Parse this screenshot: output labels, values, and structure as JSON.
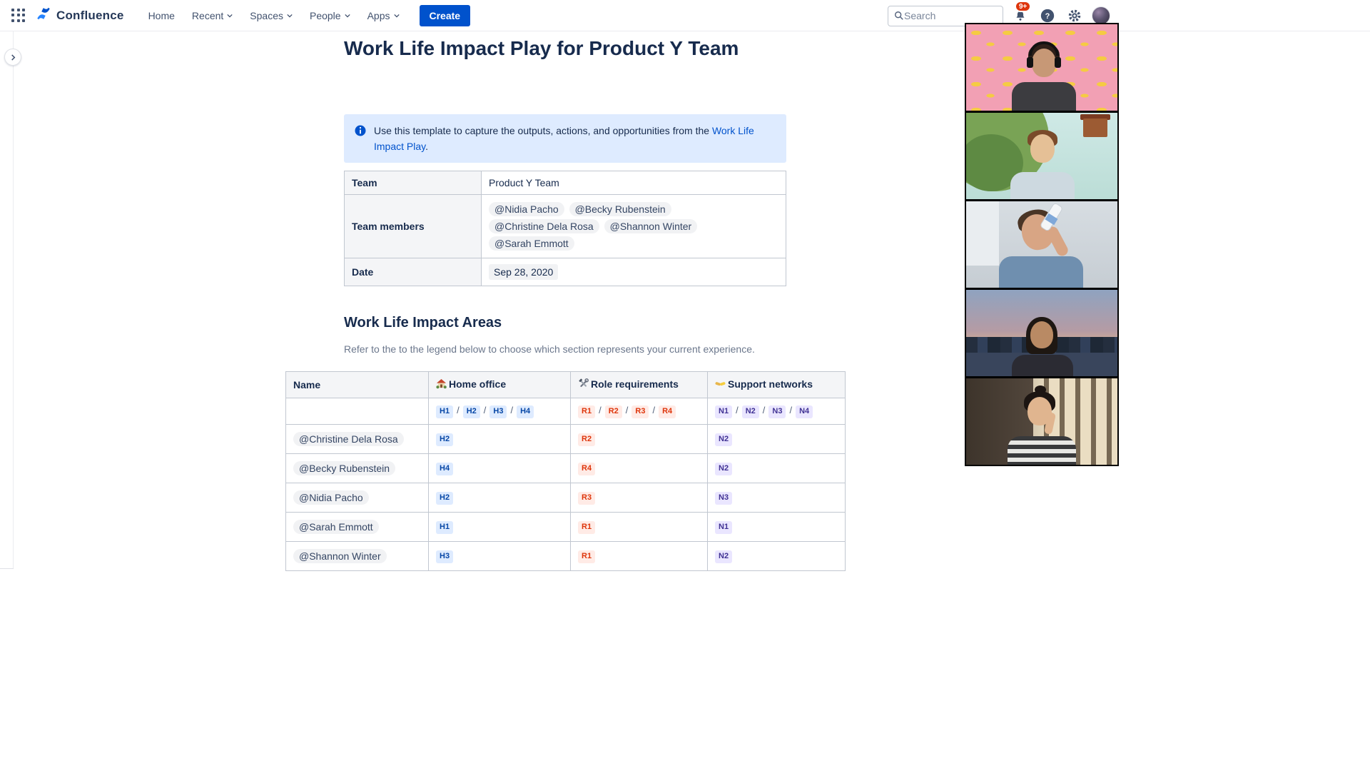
{
  "nav": {
    "brand": "Confluence",
    "items": [
      {
        "label": "Home"
      },
      {
        "label": "Recent"
      },
      {
        "label": "Spaces"
      },
      {
        "label": "People"
      },
      {
        "label": "Apps"
      }
    ],
    "create_label": "Create",
    "search_placeholder": "Search",
    "notification_badge": "9+"
  },
  "page": {
    "title": "Work Life Impact Play for Product Y Team",
    "info": {
      "before": "Use this template to capture the outputs, actions, and opportunities from the ",
      "link": "Work Life Impact Play",
      "after": "."
    },
    "team_table": {
      "team_label": "Team",
      "team_value": "Product Y Team",
      "members_label": "Team members",
      "members": [
        "@Nidia Pacho",
        "@Becky Rubenstein",
        "@Christine Dela Rosa",
        "@Shannon Winter",
        "@Sarah Emmott"
      ],
      "date_label": "Date",
      "date_value": "Sep 28, 2020"
    },
    "section_heading": "Work Life Impact Areas",
    "section_subtext": "Refer to the to the legend below to choose which section represents your current experience.",
    "impact_table": {
      "headers": {
        "name": "Name",
        "home": "Home office",
        "home_icon": "house",
        "role": "Role requirements",
        "role_icon": "hammer-and-wrench",
        "network": "Support networks",
        "network_icon": "handshake"
      },
      "separator": "/",
      "legend": {
        "home": [
          "H1",
          "H2",
          "H3",
          "H4"
        ],
        "role": [
          "R1",
          "R2",
          "R3",
          "R4"
        ],
        "network": [
          "N1",
          "N2",
          "N3",
          "N4"
        ]
      },
      "rows": [
        {
          "name": "@Christine Dela Rosa",
          "home": "H2",
          "role": "R2",
          "network": "N2"
        },
        {
          "name": "@Becky Rubenstein",
          "home": "H4",
          "role": "R4",
          "network": "N2"
        },
        {
          "name": "@Nidia Pacho",
          "home": "H2",
          "role": "R3",
          "network": "N3"
        },
        {
          "name": "@Sarah Emmott",
          "home": "H1",
          "role": "R1",
          "network": "N1"
        },
        {
          "name": "@Shannon Winter",
          "home": "H3",
          "role": "R1",
          "network": "N2"
        }
      ]
    }
  },
  "video_call": {
    "tiles": [
      {
        "desc": "participant with headset, banana pattern background"
      },
      {
        "desc": "participant with illustrated tree background"
      },
      {
        "desc": "participant drinking from a water bottle"
      },
      {
        "desc": "participant with city skyline background"
      },
      {
        "desc": "participant in striped shirt by window blinds"
      }
    ]
  },
  "colors": {
    "brand_blue": "#0052CC",
    "info_panel_bg": "#DEEBFF",
    "lozenge_blue_bg": "#DEEBFF",
    "lozenge_blue_text": "#0747A6",
    "lozenge_red_bg": "#FFEBE6",
    "lozenge_red_text": "#DE350B",
    "lozenge_purple_bg": "#EAE6FF",
    "lozenge_purple_text": "#403294"
  }
}
